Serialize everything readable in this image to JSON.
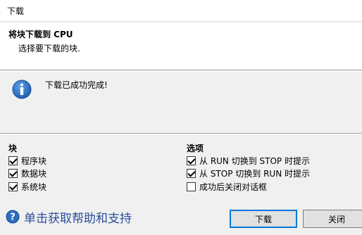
{
  "window": {
    "title": "下载"
  },
  "header": {
    "title": "将块下载到 CPU",
    "subtitle": "选择要下载的块."
  },
  "message": {
    "icon": "info-icon",
    "text": "下载已成功完成!"
  },
  "blocks": {
    "title": "块",
    "items": [
      {
        "label": "程序块",
        "checked": true
      },
      {
        "label": "数据块",
        "checked": true
      },
      {
        "label": "系统块",
        "checked": true
      }
    ]
  },
  "options": {
    "title": "选项",
    "items": [
      {
        "label": "从 RUN 切换到 STOP 时提示",
        "checked": true
      },
      {
        "label": "从 STOP 切换到 RUN 时提示",
        "checked": true
      },
      {
        "label": "成功后关闭对话框",
        "checked": false
      }
    ]
  },
  "help": {
    "icon": "help-icon",
    "text": "单击获取帮助和支持"
  },
  "buttons": {
    "download": "下载",
    "close": "关闭"
  },
  "colors": {
    "accent": "#0078d7",
    "help_link": "#2b4c9c",
    "info_blue": "#1f5fae"
  }
}
